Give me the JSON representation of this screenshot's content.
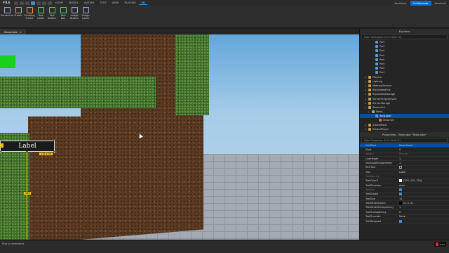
{
  "menubar": {
    "file": "FILE",
    "tabs": [
      "HOME",
      "MODEL",
      "AVATAR",
      "TEST",
      "VIEW",
      "PLUGINS",
      "UI"
    ],
    "active_tab": "UI",
    "assistant": "Assistant",
    "collaborate": "Collaborate",
    "user": "Newhold"
  },
  "ribbon": {
    "tools": [
      {
        "label": "ScreenGui",
        "icon": "screengui-icon"
      },
      {
        "label": "Frame",
        "icon": "frame-icon"
      },
      {
        "label": "Scrolling Frame",
        "icon": "scrolling-frame-icon"
      },
      {
        "label": "Text Label",
        "icon": "text-label-icon"
      },
      {
        "label": "Text Button",
        "icon": "text-button-icon"
      },
      {
        "label": "Text Box",
        "icon": "text-box-icon"
      },
      {
        "label": "Image Button",
        "icon": "image-button-icon"
      },
      {
        "label": "Image Label",
        "icon": "image-label-icon"
      }
    ]
  },
  "document": {
    "tab_label": "Baseplate"
  },
  "viewport": {
    "label_text": "Label",
    "size_badge": "231 x 30",
    "guide_badge": "392"
  },
  "explorer": {
    "title": "Explorer",
    "filter_placeholder": "Filter workspace (Ctrl+Shift+X)",
    "rows": [
      {
        "label": "Part",
        "indent": 3,
        "selected": false
      },
      {
        "label": "Part",
        "indent": 3,
        "selected": false
      },
      {
        "label": "Part",
        "indent": 3,
        "selected": false
      },
      {
        "label": "Part",
        "indent": 3,
        "selected": false
      },
      {
        "label": "Part",
        "indent": 3,
        "selected": false
      },
      {
        "label": "Part",
        "indent": 3,
        "selected": false
      },
      {
        "label": "Part",
        "indent": 3,
        "selected": false
      },
      {
        "label": "Part",
        "indent": 3,
        "selected": false
      },
      {
        "label": "Players",
        "indent": 1,
        "selected": false
      },
      {
        "label": "Lighting",
        "indent": 1,
        "selected": false
      },
      {
        "label": "MaterialService",
        "indent": 1,
        "selected": false
      },
      {
        "label": "ReplicatedFirst",
        "indent": 1,
        "selected": false
      },
      {
        "label": "ReplicatedStorage",
        "indent": 1,
        "selected": false
      },
      {
        "label": "ServerScriptService",
        "indent": 1,
        "selected": false
      },
      {
        "label": "ServerStorage",
        "indent": 1,
        "selected": false
      },
      {
        "label": "StarterGui",
        "indent": 1,
        "selected": false
      },
      {
        "label": "Menu",
        "indent": 2,
        "selected": false
      },
      {
        "label": "TextLabel",
        "indent": 3,
        "selected": true
      },
      {
        "label": "UICorner",
        "indent": 4,
        "selected": false
      },
      {
        "label": "StarterPack",
        "indent": 1,
        "selected": false
      },
      {
        "label": "StarterPlayer",
        "indent": 1,
        "selected": false
      }
    ]
  },
  "properties": {
    "title": "Properties - TextLabel \"TextLabel\"",
    "filter_placeholder": "Filter Properties (Ctrl+Shift+P)",
    "rows": [
      {
        "name": "FontFace",
        "value": "Rose Arrow",
        "dim": false,
        "selected": true,
        "kind": "text"
      },
      {
        "name": "Style",
        "value": "0",
        "dim": false,
        "selected": false,
        "kind": "text"
      },
      {
        "name": "Weight",
        "value": "Regular",
        "dim": true,
        "selected": false,
        "kind": "text"
      },
      {
        "name": "LineHeight",
        "value": "1",
        "dim": false,
        "selected": false,
        "kind": "text"
      },
      {
        "name": "MaxVisibleGraphemes",
        "value": "-1",
        "dim": false,
        "selected": false,
        "kind": "text"
      },
      {
        "name": "RichText",
        "value": "",
        "dim": false,
        "selected": false,
        "kind": "check-off"
      },
      {
        "name": "Text",
        "value": "Label",
        "dim": false,
        "selected": false,
        "kind": "text"
      },
      {
        "name": "TextBounds",
        "value": "",
        "dim": true,
        "selected": false,
        "kind": "text"
      },
      {
        "name": "TextColor3",
        "value": "[255, 255, 255]",
        "dim": false,
        "selected": false,
        "kind": "swatch"
      },
      {
        "name": "TextDirection",
        "value": "Auto",
        "dim": false,
        "selected": false,
        "kind": "text"
      },
      {
        "name": "TextFits",
        "value": "",
        "dim": true,
        "selected": false,
        "kind": "check-on"
      },
      {
        "name": "TextScaled",
        "value": "",
        "dim": false,
        "selected": false,
        "kind": "check-on"
      },
      {
        "name": "TextSize",
        "value": "14",
        "dim": false,
        "selected": false,
        "kind": "text"
      },
      {
        "name": "TextStrokeColor3",
        "value": "[0, 0, 0]",
        "dim": false,
        "selected": false,
        "kind": "swatch-dark"
      },
      {
        "name": "TextStrokeTransparency",
        "value": "1",
        "dim": false,
        "selected": false,
        "kind": "text"
      },
      {
        "name": "TextTransparency",
        "value": "0",
        "dim": false,
        "selected": false,
        "kind": "text"
      },
      {
        "name": "TextTruncate",
        "value": "None",
        "dim": false,
        "selected": false,
        "kind": "text"
      },
      {
        "name": "TextWrapped",
        "value": "",
        "dim": false,
        "selected": false,
        "kind": "check-on"
      }
    ]
  },
  "statusbar": {
    "command_placeholder": "Run a command",
    "stat": "0.0/s"
  },
  "colors": {
    "accent": "#0a6cd6",
    "selection": "#0a4f9c",
    "guide": "#f2c21b"
  }
}
